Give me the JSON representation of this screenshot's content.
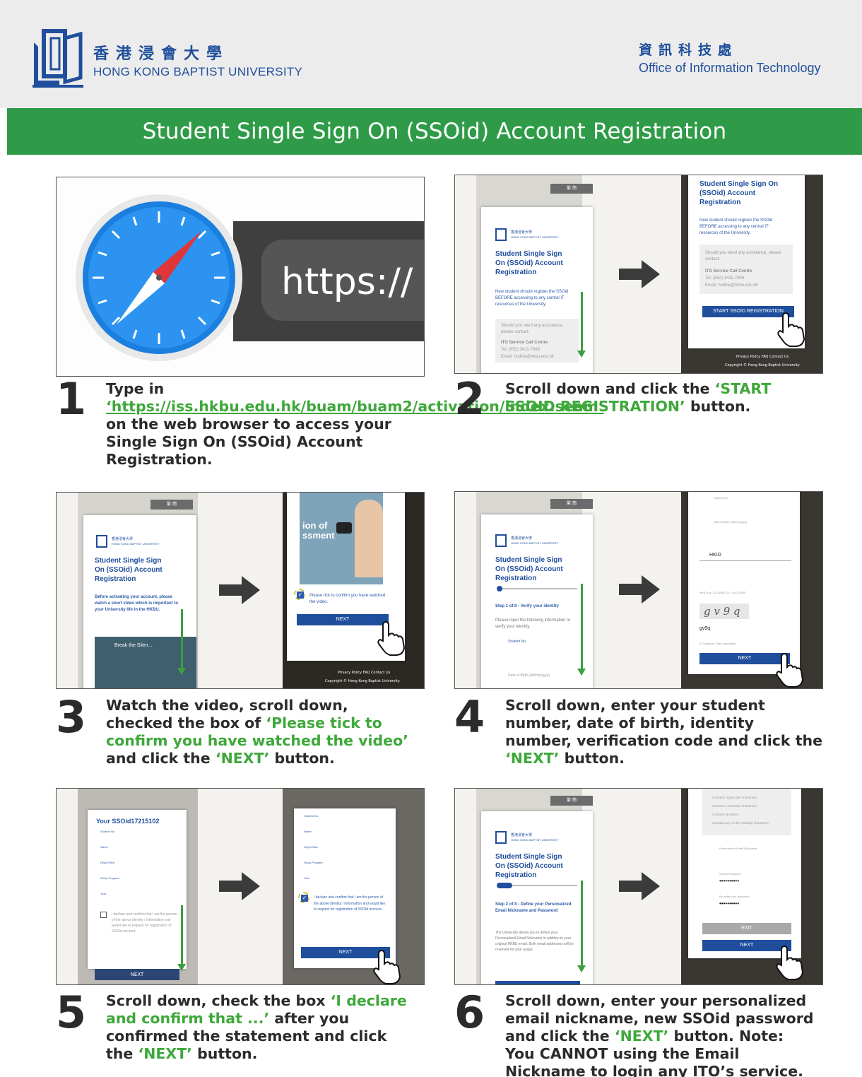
{
  "header": {
    "uni_zh": "香港浸會大學",
    "uni_en": "HONG KONG BAPTIST UNIVERSITY",
    "ito_zh": "資訊科技處",
    "ito_en": "Office of Information Technology"
  },
  "title": "Student Single Sign On (SSOid) Account Registration",
  "colors": {
    "brand_blue": "#1f4e9c",
    "band_green": "#2f9b48",
    "accent_green": "#3ea83a"
  },
  "screens": {
    "lang": "繁  簡",
    "mini_uni_zh": "香港浸會大學",
    "mini_uni_en": "HONG KONG BAPTIST UNIVERSITY",
    "reg_title": "Student Single Sign On (SSOid) Account Registration",
    "new_student_note": "New student should register the SSOid BEFORE accessing to any central IT resources of the University.",
    "assist": "Should you need any assistance, please contact:",
    "ito_centre": "ITO Service Call Centre",
    "tel": "Tel: (852) 3411-7899",
    "email": "Email: hotline@hkbu.edu.hk",
    "start_btn": "START SSOID REGISTRATION",
    "footer_links": "Privacy Policy   FAQ   Contact Us",
    "copyright": "Copyright © Hong Kong Baptist University",
    "https": "https://",
    "video_note": "Before activating your account, please watch a short video which is important to your University life in the HKBU.",
    "video_title": "Break the Silen...",
    "video_overlay": "ion of ssment",
    "tick_video": "Please tick to confirm you have watched the video.",
    "next": "NEXT",
    "exit": "EXIT",
    "step1of8": "Step 1 of 8 - Verify your identity",
    "verify_note": "Please input the following information to verify your identity.",
    "student_no": "Student No.",
    "dob": "Date of Birth (dd/mm/yyyy)",
    "hkid": "HKID",
    "hkid_hint": "HKID e.g.: A1234567(1) -> A1234567",
    "captcha": "g v 9  q",
    "captcha_input": "gv9q",
    "captcha_hint": "4-Character Case-insensitive",
    "your_ssoid": "Your SSOid17215102",
    "name_lbl": "Name",
    "dept_lbl": "Dept/Office",
    "program_lbl": "Study Program",
    "year_lbl": "Year",
    "declare": "I declare and confirm that I am the person of the above identity / information and would like to request for registration of SSOid account.",
    "step2of8": "Step 2 of 8 - Define your Personalized Email Nickname and Password",
    "nickname_note": "The University allows you to define your Personalized Email Nickname in addition to your original HKBU email. Both email addresses will be reserved for your usage.",
    "pw_rules": [
      "Contains Uppercase characters",
      "Contains Lowercase characters",
      "Contains Numbers",
      "Contains any of the following characters"
    ],
    "nickname_lbl": "Personalized Email Nickname",
    "ssoid_pw": "SSOid Password",
    "reenter_pw": "Re-enter your password",
    "pw_mask": "••••••••••"
  },
  "steps": [
    {
      "number": "1",
      "parts": [
        {
          "t": "Type in ",
          "style": "plain"
        },
        {
          "t": "‘https://iss.hkbu.edu.hk/buam/buam2/activation/index.seam’",
          "style": "link"
        },
        {
          "t": " on the web browser to access your Single Sign On (SSOid) Account Registration.",
          "style": "plain"
        }
      ]
    },
    {
      "number": "2",
      "parts": [
        {
          "t": "Scroll down and click the ",
          "style": "plain"
        },
        {
          "t": "‘START SSOID REGISTRATION’",
          "style": "green"
        },
        {
          "t": " button.",
          "style": "plain"
        }
      ]
    },
    {
      "number": "3",
      "parts": [
        {
          "t": "Watch the video, scroll down, checked the box of ",
          "style": "plain"
        },
        {
          "t": "‘Please tick to confirm you have watched the video’",
          "style": "green"
        },
        {
          "t": " and click the ",
          "style": "plain"
        },
        {
          "t": "‘NEXT’",
          "style": "green"
        },
        {
          "t": " button.",
          "style": "plain"
        }
      ]
    },
    {
      "number": "4",
      "parts": [
        {
          "t": "Scroll down, enter your student number, date of birth, identity number, verification code and click the ",
          "style": "plain"
        },
        {
          "t": "‘NEXT’",
          "style": "green"
        },
        {
          "t": " button.",
          "style": "plain"
        }
      ]
    },
    {
      "number": "5",
      "parts": [
        {
          "t": "Scroll down, check the box ",
          "style": "plain"
        },
        {
          "t": "‘I declare and confirm that ...’",
          "style": "green"
        },
        {
          "t": " after you confirmed the statement and click the ",
          "style": "plain"
        },
        {
          "t": "‘NEXT’",
          "style": "green"
        },
        {
          "t": " button.",
          "style": "plain"
        }
      ]
    },
    {
      "number": "6",
      "parts": [
        {
          "t": "Scroll down, enter your personalized email nickname, new SSOid password and click the ",
          "style": "plain"
        },
        {
          "t": "‘NEXT’",
          "style": "green"
        },
        {
          "t": " button. Note: You CANNOT using the Email Nickname to login any ITO’s service.",
          "style": "plain"
        }
      ]
    }
  ]
}
